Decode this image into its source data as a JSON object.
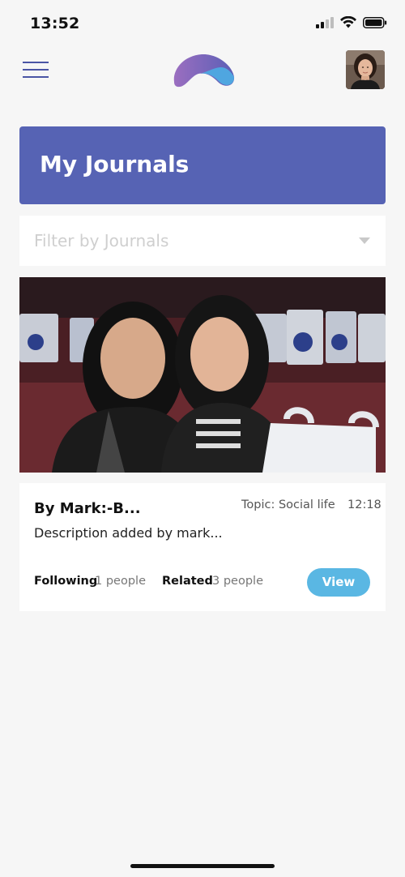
{
  "status_bar": {
    "time": "13:52"
  },
  "header": {
    "menu_icon": "hamburger-icon",
    "logo_icon": "app-logo-icon",
    "avatar_icon": "user-avatar"
  },
  "page": {
    "title": "My Journals"
  },
  "filter": {
    "placeholder": "Filter by Journals"
  },
  "journal_card": {
    "author": "By Mark:-B...",
    "topic": "Topic: Social life",
    "time": "12:18",
    "description": "Description added by mark...",
    "following_label": "Following",
    "following_value": "1 people",
    "related_label": "Related",
    "related_value": "3 people",
    "view_button": "View"
  },
  "colors": {
    "banner": "#5663b4",
    "view_button": "#5ab7e3",
    "menu_lines": "#4a55a5"
  }
}
